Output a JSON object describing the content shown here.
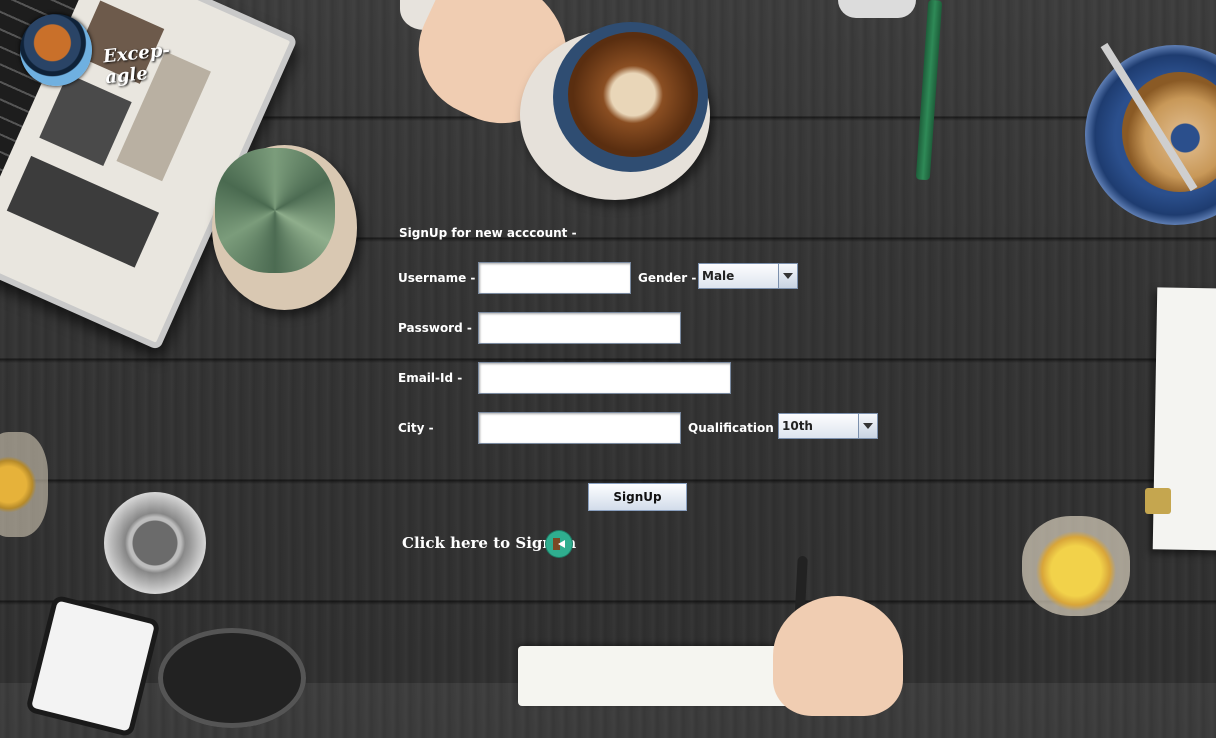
{
  "logo": {
    "text": "Excep-agle"
  },
  "form": {
    "heading": "SignUp for new acccount -",
    "username_label": "Username -",
    "password_label": "Password -",
    "email_label": "Email-Id -",
    "city_label": "City -",
    "gender_label": "Gender -",
    "gender_value": "Male",
    "qualification_label": "Qualification -",
    "qualification_value": "10th",
    "username_value": "",
    "password_value": "",
    "email_value": "",
    "city_value": "",
    "signup_button": "SignUp",
    "signin_link": "Click here to Sign-in"
  },
  "icons": {
    "logo": "eagle-logo-icon",
    "signin": "sign-in-door-icon",
    "dropdown": "chevron-down-icon"
  }
}
